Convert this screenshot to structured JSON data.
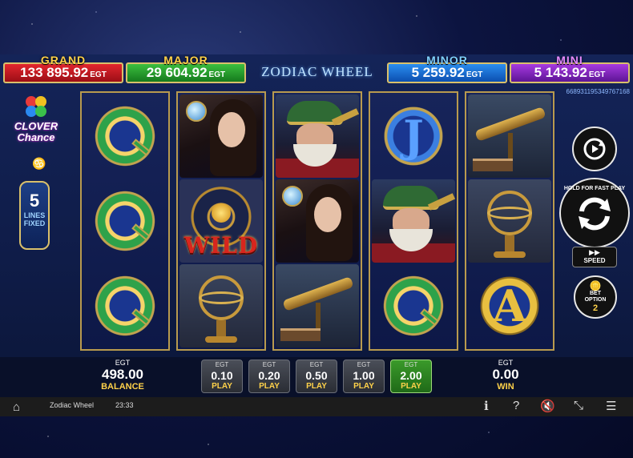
{
  "jackpots": {
    "grand": {
      "label": "GRAND",
      "amount": "133 895.92",
      "currency": "EGT"
    },
    "major": {
      "label": "MAJOR",
      "amount": "29 604.92",
      "currency": "EGT"
    },
    "minor": {
      "label": "MINOR",
      "amount": "5 259.92",
      "currency": "EGT"
    },
    "mini": {
      "label": "MINI",
      "amount": "5 143.92",
      "currency": "EGT"
    }
  },
  "game_logo": "ZODIAC WHEEL",
  "game_id": "66893119534976​7168",
  "clover": {
    "line1": "CLOVER",
    "line2": "Chance"
  },
  "lines": {
    "count": "5",
    "label1": "LINES",
    "label2": "FIXED"
  },
  "reels": [
    [
      "Q",
      "Q",
      "Q"
    ],
    [
      "woman",
      "wild",
      "armillary"
    ],
    [
      "man",
      "woman",
      "telescope"
    ],
    [
      "J",
      "man",
      "Q"
    ],
    [
      "telescope",
      "armillary",
      "A"
    ]
  ],
  "wild_text": "WILD",
  "controls": {
    "hold_text": "HOLD FOR FAST PLAY",
    "speed_label": "SPEED",
    "bet_option_label1": "BET",
    "bet_option_label2": "OPTION",
    "bet_option_value": "2"
  },
  "balance": {
    "currency": "EGT",
    "value": "498.00",
    "label": "BALANCE"
  },
  "win": {
    "currency": "EGT",
    "value": "0.00",
    "label": "WIN"
  },
  "bets": [
    {
      "currency": "EGT",
      "amount": "0.10",
      "label": "PLAY",
      "active": false
    },
    {
      "currency": "EGT",
      "amount": "0.20",
      "label": "PLAY",
      "active": false
    },
    {
      "currency": "EGT",
      "amount": "0.50",
      "label": "PLAY",
      "active": false
    },
    {
      "currency": "EGT",
      "amount": "1.00",
      "label": "PLAY",
      "active": false
    },
    {
      "currency": "EGT",
      "amount": "2.00",
      "label": "PLAY",
      "active": true
    }
  ],
  "system_bar": {
    "title": "Zodiac Wheel",
    "clock": "23:33"
  },
  "icons": [
    "home-icon",
    "info-icon",
    "help-icon",
    "mute-icon",
    "fullscreen-exit-icon",
    "menu-icon"
  ]
}
